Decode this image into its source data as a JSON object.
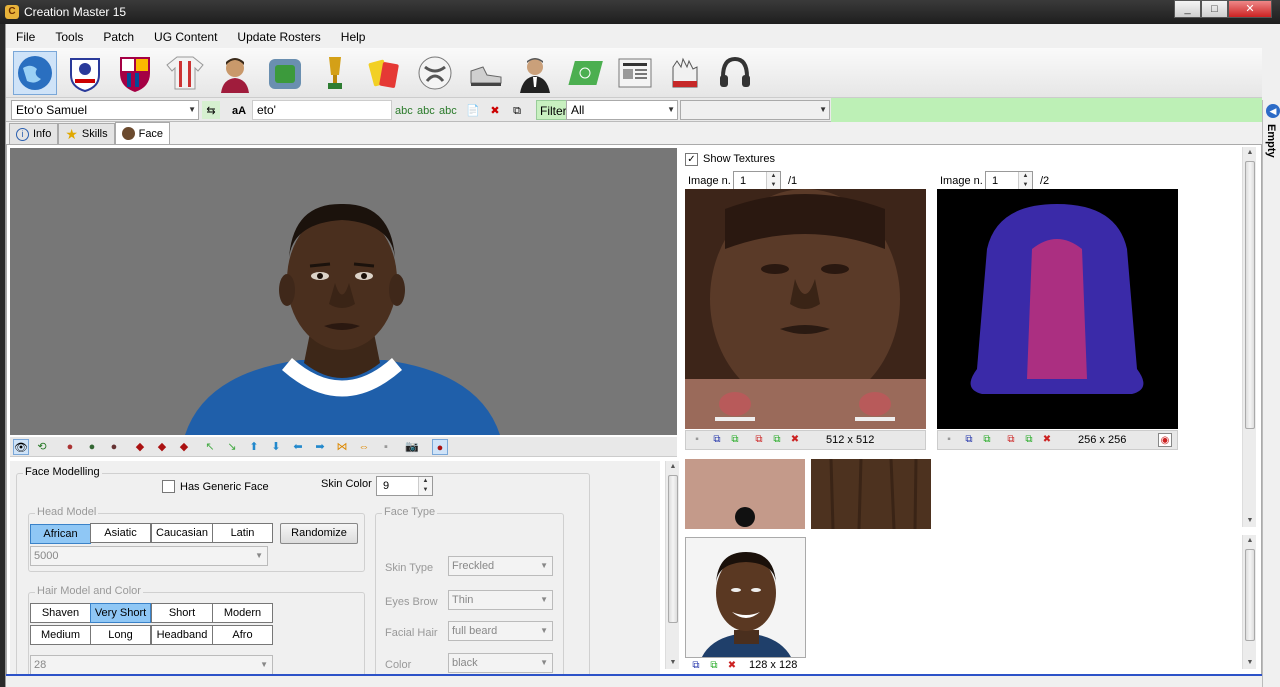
{
  "window": {
    "title": "Creation Master 15",
    "controls": [
      "minimize",
      "maximize",
      "close"
    ]
  },
  "menu": [
    "File",
    "Tools",
    "Patch",
    "UG Content",
    "Update Rosters",
    "Help"
  ],
  "toolbar_icons": [
    "globe-icon",
    "premier-league-icon",
    "barcelona-crest-icon",
    "jersey-icon",
    "player-icon",
    "stadium-icon",
    "trophy-icon",
    "referee-card-icon",
    "ball-icon",
    "boot-icon",
    "manager-icon",
    "pitch-icon",
    "newspaper-icon",
    "gloves-icon",
    "headphones-icon"
  ],
  "player_bar": {
    "player_select": "Eto'o Samuel",
    "search_text": "eto'",
    "aa_label": "aA",
    "filter_label": "Filter",
    "filter_value": "All",
    "filter2_value": ""
  },
  "tabs": [
    {
      "label": "Info",
      "icon": "info-icon"
    },
    {
      "label": "Skills",
      "icon": "star-icon"
    },
    {
      "label": "Face",
      "icon": "face-icon",
      "active": true
    }
  ],
  "face_modelling": {
    "group_label": "Face Modelling",
    "generic_face_label": "Has Generic Face",
    "generic_face_checked": false,
    "skin_color_label": "Skin Color",
    "skin_color_value": "9",
    "head_model": {
      "label": "Head Model",
      "options": [
        "African",
        "Asiatic",
        "Caucasian",
        "Latin"
      ],
      "selected": "African",
      "randomize_label": "Randomize",
      "id_value": "5000"
    },
    "hair": {
      "label": "Hair Model and Color",
      "row1": [
        "Shaven",
        "Very Short",
        "Short",
        "Modern"
      ],
      "row2": [
        "Medium",
        "Long",
        "Headband",
        "Afro"
      ],
      "selected": "Very Short",
      "id_value": "28"
    },
    "face_type": {
      "label": "Face Type",
      "skin_type_label": "Skin Type",
      "skin_type": "Freckled",
      "eyebrow_label": "Eyes Brow",
      "eyebrow": "Thin",
      "facial_hair_label": "Facial Hair",
      "facial_hair": "full beard",
      "color_label": "Color",
      "color": "black"
    }
  },
  "textures": {
    "show_label": "Show Textures",
    "show_checked": true,
    "face": {
      "label": "Image n.",
      "value": "1",
      "total": "/1",
      "size": "512 x 512"
    },
    "hair": {
      "label": "Image n.",
      "value": "1",
      "total": "/2",
      "size": "256 x 256"
    },
    "photo_size": "128 x 128"
  },
  "side_panel": {
    "label": "Empty"
  },
  "colors": {
    "selected_button": "#8fc7f5",
    "green_bar": "#bdf0b6",
    "status_line": "#2c52c8"
  }
}
